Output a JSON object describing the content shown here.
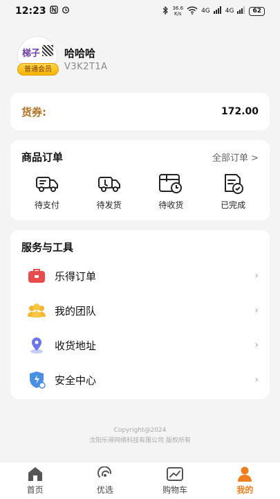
{
  "status_bar": {
    "time": "12:23",
    "net_speed_top": "36.6",
    "net_speed_bottom": "K/s",
    "signal1": "4G",
    "signal2": "4G",
    "battery": "62"
  },
  "profile": {
    "avatar_text": "梯子",
    "member_badge": "普通会员",
    "name": "哈哈哈",
    "code": "V3K2T1A"
  },
  "voucher": {
    "label": "货券:",
    "value": "172.00"
  },
  "orders": {
    "title": "商品订单",
    "all_link": "全部订单 >",
    "items": [
      {
        "label": "待支付",
        "icon": "truck-icon"
      },
      {
        "label": "待发货",
        "icon": "truck-icon"
      },
      {
        "label": "待收货",
        "icon": "receive-clock-icon"
      },
      {
        "label": "已完成",
        "icon": "document-check-icon"
      }
    ]
  },
  "tools": {
    "title": "服务与工具",
    "items": [
      {
        "label": "乐得订单",
        "icon": "briefcase-icon"
      },
      {
        "label": "我的团队",
        "icon": "team-icon"
      },
      {
        "label": "收货地址",
        "icon": "location-icon"
      },
      {
        "label": "安全中心",
        "icon": "shield-icon"
      }
    ]
  },
  "footer": {
    "copyright": "Copyright@2024",
    "company": "沈阳乐得网络科技有限公司  版权所有"
  },
  "tabbar": {
    "items": [
      {
        "label": "首页",
        "icon": "home-icon"
      },
      {
        "label": "优选",
        "icon": "select-icon"
      },
      {
        "label": "购物车",
        "icon": "cart-icon"
      },
      {
        "label": "我的",
        "icon": "user-icon"
      }
    ]
  },
  "colors": {
    "accent": "#f07d1e",
    "voucher_label": "#b07222",
    "background": "#f4f4f5"
  }
}
